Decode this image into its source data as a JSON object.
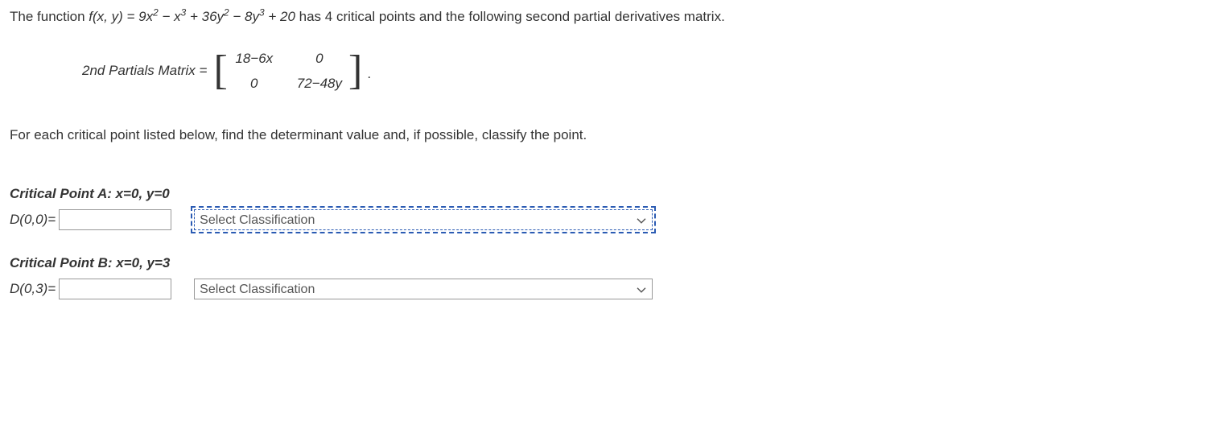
{
  "intro": {
    "prefix": "The function  ",
    "func": "f(x, y) = 9x² − x³ + 36y² − 8y³ + 20",
    "suffix": "  has 4 critical points and the following second partial derivatives matrix."
  },
  "matrix": {
    "label": "2nd Partials Matrix =",
    "m11": "18−6x",
    "m12": "0",
    "m21": "0",
    "m22": "72−48y",
    "period": "."
  },
  "instruction": "For each critical point listed below, find the determinant value and, if possible, classify the point.",
  "pointA": {
    "header": "Critical Point A: x=0, y=0",
    "det_label": "D(0,0)=",
    "det_value": "",
    "select_placeholder": "Select Classification"
  },
  "pointB": {
    "header": "Critical Point B: x=0, y=3",
    "det_label": "D(0,3)=",
    "det_value": "",
    "select_placeholder": "Select Classification"
  }
}
